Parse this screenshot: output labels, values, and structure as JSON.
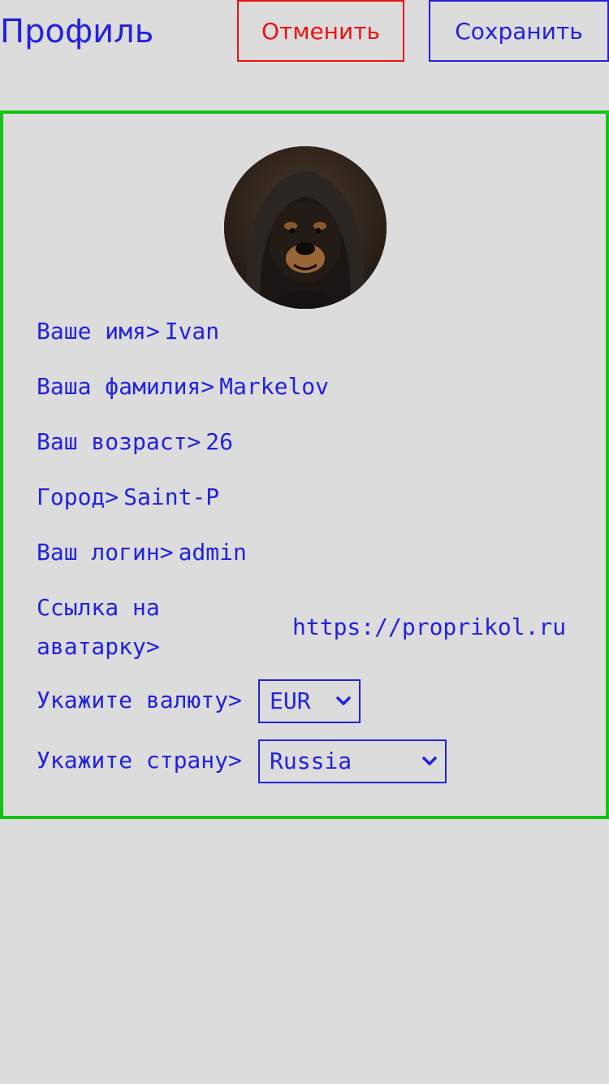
{
  "header": {
    "title": "Профиль",
    "cancel_label": "Отменить",
    "save_label": "Сохранить"
  },
  "profile": {
    "avatar_icon": "dog-in-hood-avatar",
    "fields": {
      "name_label": "Ваше имя>",
      "name_value": "Ivan",
      "surname_label": "Ваша фамилия>",
      "surname_value": "Markelov",
      "age_label": "Ваш возраст>",
      "age_value": "26",
      "city_label": "Город>",
      "city_value": "Saint-P",
      "login_label": "Ваш логин>",
      "login_value": "admin",
      "avatar_link_label": "Ссылка на аватарку>",
      "avatar_link_value": "https://proprikol.ru"
    },
    "currency": {
      "label": "Укажите валюту>",
      "selected": "EUR"
    },
    "country": {
      "label": "Укажите страну>",
      "selected": "Russia"
    }
  },
  "colors": {
    "accent": "#2222dd",
    "danger": "#ee1111",
    "panel_border": "#11c411",
    "background": "#dcdcdc"
  }
}
